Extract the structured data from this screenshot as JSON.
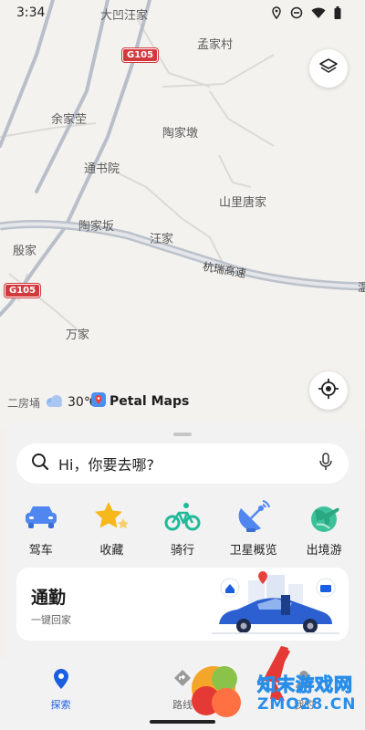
{
  "status_bar": {
    "time": "3:34"
  },
  "map": {
    "places": {
      "dawang": "大凹汪家",
      "mengjiacun": "孟家村",
      "yujiaying": "余家茔",
      "taojiadun": "陶家墩",
      "tongshuyuan": "通书院",
      "shanlitangjia": "山里唐家",
      "taojiaban": "陶家坂",
      "wangjia": "汪家",
      "yinjia": "殷家",
      "wanjia": "万家"
    },
    "roads": {
      "g105_top": "G105",
      "g105_left": "G105",
      "hangrui": "杭瑞高速",
      "edge_char": "温"
    },
    "weather": {
      "partial_place": "二房埇",
      "temperature": "30℃"
    },
    "brand": "Petal Maps"
  },
  "search": {
    "placeholder": "Hi，你要去哪?"
  },
  "shortcuts": [
    {
      "label": "驾车",
      "icon": "car-icon"
    },
    {
      "label": "收藏",
      "icon": "star-icon"
    },
    {
      "label": "骑行",
      "icon": "bike-icon"
    },
    {
      "label": "卫星概览",
      "icon": "satellite-icon"
    },
    {
      "label": "出境游",
      "icon": "plane-icon"
    }
  ],
  "commute": {
    "title": "通勤",
    "subtitle": "一键回家"
  },
  "bottom_nav": [
    {
      "label": "探索",
      "icon": "location-pin-icon",
      "active": true
    },
    {
      "label": "路线",
      "icon": "route-icon",
      "active": false
    },
    {
      "label": "我的",
      "icon": "profile-icon",
      "active": false
    }
  ],
  "watermark": {
    "line1": "知末游戏网",
    "line2": "ZMO28.CN"
  },
  "colors": {
    "accent": "#1a5fe0",
    "shield_red": "#d2393d",
    "highway": "#c8ccd3"
  }
}
